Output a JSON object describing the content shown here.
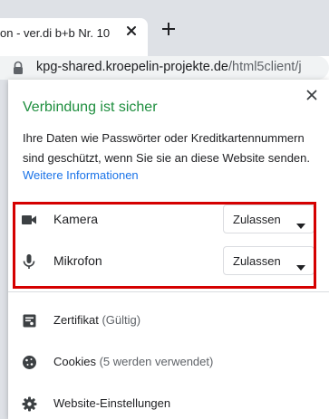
{
  "browser": {
    "tab": {
      "title": "on - ver.di b+b Nr. 10",
      "close_icon": "close-icon"
    },
    "new_tab_icon": "plus-icon",
    "address_bar": {
      "lock_icon": "lock-icon",
      "host": "kpg-shared.kroepelin-projekte.de",
      "path": "/html5client/j"
    }
  },
  "site_info": {
    "title": "Verbindung ist sicher",
    "description": "Ihre Daten wie Passwörter oder Kreditkartennummern sind geschützt, wenn Sie sie an diese Website senden.",
    "link": "Weitere Informationen",
    "permissions": [
      {
        "icon": "camera-icon",
        "label": "Kamera",
        "value": "Zulassen"
      },
      {
        "icon": "microphone-icon",
        "label": "Mikrofon",
        "value": "Zulassen"
      }
    ],
    "items": [
      {
        "icon": "certificate-icon",
        "label": "Zertifikat",
        "detail": "(Gültig)"
      },
      {
        "icon": "cookie-icon",
        "label": "Cookies",
        "detail": "(5 werden verwendet)"
      },
      {
        "icon": "gear-icon",
        "label": "Website-Einstellungen",
        "detail": ""
      }
    ]
  },
  "colors": {
    "secure_green": "#1e8e3e",
    "link_blue": "#1a73e8",
    "highlight_red": "#d50000"
  }
}
